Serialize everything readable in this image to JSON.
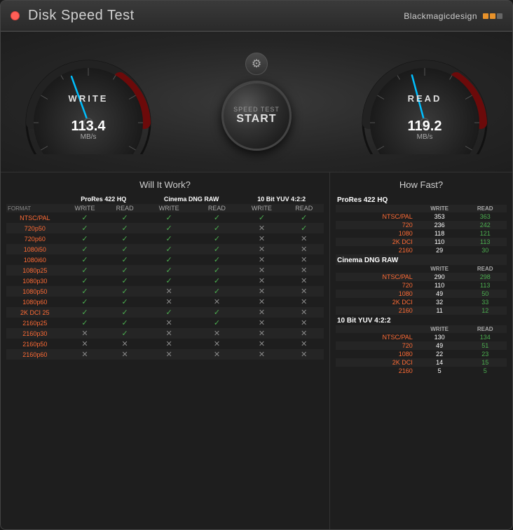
{
  "titleBar": {
    "title": "Disk Speed Test",
    "brand": "Blackmagicdesign",
    "closeBtn": "×"
  },
  "gauges": {
    "write": {
      "label": "WRITE",
      "value": "113.4",
      "unit": "MB/s",
      "angle": -20
    },
    "read": {
      "label": "READ",
      "value": "119.2",
      "unit": "MB/s",
      "angle": -15
    }
  },
  "startButton": {
    "lineOne": "SPEED TEST",
    "lineTwo": "START"
  },
  "settingsIcon": "⚙",
  "sections": {
    "leftTitle": "Will It Work?",
    "rightTitle": "How Fast?"
  },
  "leftTable": {
    "groups": [
      {
        "name": "ProRes 422 HQ",
        "subHeaders": [
          "WRITE",
          "READ",
          "WRITE",
          "READ",
          "WRITE",
          "READ"
        ]
      }
    ],
    "codec1": "ProRes 422 HQ",
    "codec2": "Cinema DNG RAW",
    "codec3": "10 Bit YUV 4:2:2",
    "formatLabel": "FORMAT",
    "rows": [
      {
        "label": "NTSC/PAL",
        "c1w": true,
        "c1r": true,
        "c2w": true,
        "c2r": true,
        "c3w": true,
        "c3r": true
      },
      {
        "label": "720p50",
        "c1w": true,
        "c1r": true,
        "c2w": true,
        "c2r": true,
        "c3w": false,
        "c3r": true
      },
      {
        "label": "720p60",
        "c1w": true,
        "c1r": true,
        "c2w": true,
        "c2r": true,
        "c3w": false,
        "c3r": false
      },
      {
        "label": "1080i50",
        "c1w": true,
        "c1r": true,
        "c2w": true,
        "c2r": true,
        "c3w": false,
        "c3r": false
      },
      {
        "label": "1080i60",
        "c1w": true,
        "c1r": true,
        "c2w": true,
        "c2r": true,
        "c3w": false,
        "c3r": false
      },
      {
        "label": "1080p25",
        "c1w": true,
        "c1r": true,
        "c2w": true,
        "c2r": true,
        "c3w": false,
        "c3r": false
      },
      {
        "label": "1080p30",
        "c1w": true,
        "c1r": true,
        "c2w": true,
        "c2r": true,
        "c3w": false,
        "c3r": false
      },
      {
        "label": "1080p50",
        "c1w": true,
        "c1r": true,
        "c2w": false,
        "c2r": true,
        "c3w": false,
        "c3r": false
      },
      {
        "label": "1080p60",
        "c1w": true,
        "c1r": true,
        "c2w": false,
        "c2r": false,
        "c3w": false,
        "c3r": false
      },
      {
        "label": "2K DCI 25",
        "c1w": true,
        "c1r": true,
        "c2w": true,
        "c2r": true,
        "c3w": false,
        "c3r": false
      },
      {
        "label": "2160p25",
        "c1w": true,
        "c1r": true,
        "c2w": false,
        "c2r": true,
        "c3w": false,
        "c3r": false
      },
      {
        "label": "2160p30",
        "c1w": false,
        "c1r": true,
        "c2w": false,
        "c2r": false,
        "c3w": false,
        "c3r": false
      },
      {
        "label": "2160p50",
        "c1w": false,
        "c1r": false,
        "c2w": false,
        "c2r": false,
        "c3w": false,
        "c3r": false
      },
      {
        "label": "2160p60",
        "c1w": false,
        "c1r": false,
        "c2w": false,
        "c2r": false,
        "c3w": false,
        "c3r": false
      }
    ]
  },
  "rightTable": {
    "sections": [
      {
        "name": "ProRes 422 HQ",
        "rows": [
          {
            "label": "NTSC/PAL",
            "write": "353",
            "read": "363"
          },
          {
            "label": "720",
            "write": "236",
            "read": "242"
          },
          {
            "label": "1080",
            "write": "118",
            "read": "121"
          },
          {
            "label": "2K DCI",
            "write": "110",
            "read": "113"
          },
          {
            "label": "2160",
            "write": "29",
            "read": "30"
          }
        ]
      },
      {
        "name": "Cinema DNG RAW",
        "rows": [
          {
            "label": "NTSC/PAL",
            "write": "290",
            "read": "298"
          },
          {
            "label": "720",
            "write": "110",
            "read": "113"
          },
          {
            "label": "1080",
            "write": "49",
            "read": "50"
          },
          {
            "label": "2K DCI",
            "write": "32",
            "read": "33"
          },
          {
            "label": "2160",
            "write": "11",
            "read": "12"
          }
        ]
      },
      {
        "name": "10 Bit YUV 4:2:2",
        "rows": [
          {
            "label": "NTSC/PAL",
            "write": "130",
            "read": "134"
          },
          {
            "label": "720",
            "write": "49",
            "read": "51"
          },
          {
            "label": "1080",
            "write": "22",
            "read": "23"
          },
          {
            "label": "2K DCI",
            "write": "14",
            "read": "15"
          },
          {
            "label": "2160",
            "write": "5",
            "read": "5"
          }
        ]
      }
    ],
    "colHeaders": {
      "write": "WRITE",
      "read": "READ"
    }
  }
}
